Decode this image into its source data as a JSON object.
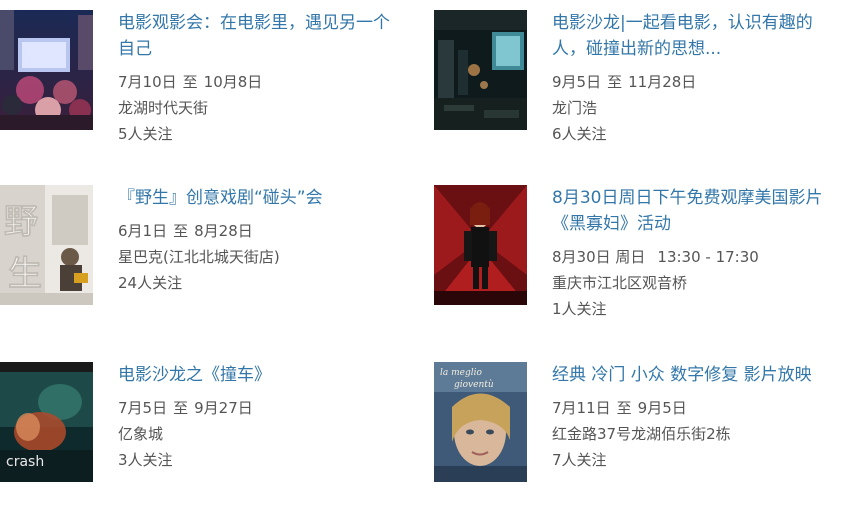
{
  "events": [
    {
      "title": "电影观影会：在电影里，遇见另一个自己",
      "date_start": "7月10日",
      "date_sep": "至",
      "date_end": "10月8日",
      "location": "龙湖时代天街",
      "followers": "5人关注",
      "thumb_icon": "outdoor-screening-photo"
    },
    {
      "title": "电影沙龙|一起看电影，认识有趣的人，碰撞出新的思想...",
      "date_start": "9月5日",
      "date_sep": "至",
      "date_end": "11月28日",
      "location": "龙门浩",
      "followers": "6人关注",
      "thumb_icon": "dark-cinema-room-photo"
    },
    {
      "title": "『野生』创意戏剧“碰头”会",
      "date_start": "6月1日",
      "date_sep": "至",
      "date_end": "8月28日",
      "location": "星巴克(江北北城天街店)",
      "followers": "24人关注",
      "thumb_icon": "wild-calligraphy-poster",
      "thumb_text": "野生"
    },
    {
      "title": "8月30日周日下午免费观摩美国影片《黑寡妇》活动",
      "date_start": "8月30日 周日",
      "date_sep": "",
      "date_end": "13:30 - 17:30",
      "location": "重庆市江北区观音桥",
      "followers": "1人关注",
      "thumb_icon": "black-widow-poster"
    },
    {
      "title": "电影沙龙之《撞车》",
      "date_start": "7月5日",
      "date_sep": "至",
      "date_end": "9月27日",
      "location": "亿象城",
      "followers": "3人关注",
      "thumb_icon": "crash-movie-poster",
      "thumb_text": "crash"
    },
    {
      "title": "经典 冷门 小众 数字修复 影片放映",
      "date_start": "7月11日",
      "date_sep": "至",
      "date_end": "9月5日",
      "location": "红金路37号龙湖佰乐街2栋",
      "followers": "7人关注",
      "thumb_icon": "la-meglio-gioventu-poster",
      "thumb_text": "la meglio gioventù"
    }
  ]
}
